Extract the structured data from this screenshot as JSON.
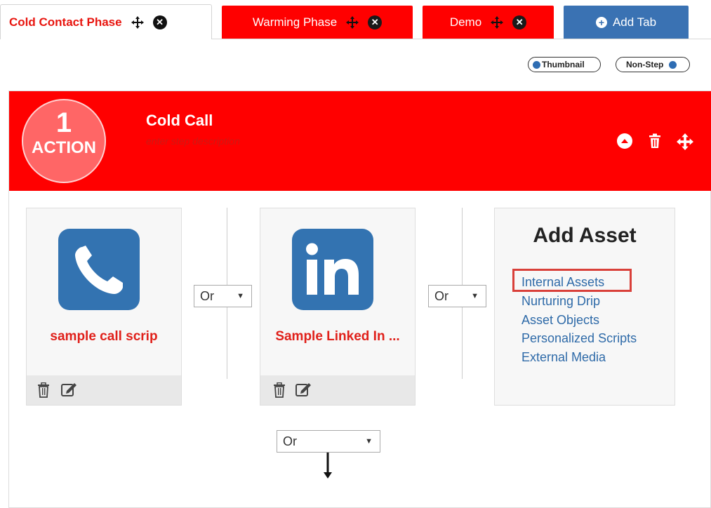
{
  "tabs": [
    {
      "label": "Cold Contact Phase",
      "active": true
    },
    {
      "label": "Warming Phase",
      "active": false
    },
    {
      "label": "Demo",
      "active": false
    }
  ],
  "add_tab_label": "Add Tab",
  "toggles": {
    "thumbnail": "Thumbnail",
    "nonstep": "Non-Step"
  },
  "step": {
    "number": "1",
    "type": "ACTION",
    "title": "Cold Call",
    "description_placeholder": "enter step description"
  },
  "assets": [
    {
      "title": "sample call scrip",
      "icon": "phone-icon"
    },
    {
      "title": "Sample Linked In ...",
      "icon": "linkedin-icon"
    }
  ],
  "or_selects": [
    "Or",
    "Or"
  ],
  "bottom_select": "Or",
  "add_asset": {
    "title": "Add Asset",
    "options": [
      "Internal Assets",
      "Nurturing Drip",
      "Asset Objects",
      "Personalized Scripts",
      "External Media"
    ]
  },
  "colors": {
    "red": "#ff0000",
    "blue": "#3a72b3",
    "link": "#2e6aa8"
  }
}
